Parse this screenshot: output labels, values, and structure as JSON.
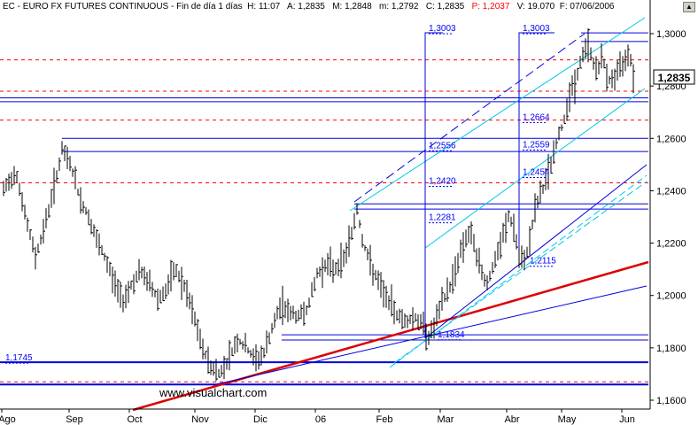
{
  "title": {
    "symbol": "EC - EURO FX FUTURES CONTINUOUS - Fin de día 1 días",
    "hour": "H: 11:07",
    "open": "A: 1,2835",
    "high": "M: 1,2848",
    "low": "m: 1,2792",
    "close": "C: 1,2835",
    "prev_label": "P: 1,2037",
    "volume": "V: 19.070",
    "date": "F: 07/06/2006"
  },
  "last_price": "1,2835",
  "watermark": "www.visualchart.com",
  "colors": {
    "bars": "#000000",
    "levels": "#0000ff",
    "dashed": "#ff0000",
    "trend_red": "#dd0000",
    "channel_cyan": "#00c8e8",
    "channel_blue": "#0000dd"
  },
  "chart_data": {
    "type": "ohlc",
    "y_ticks": [
      "1,3000",
      "1,2800",
      "1,2600",
      "1,2400",
      "1,2200",
      "1,2000",
      "1,1800",
      "1,1600"
    ],
    "y_tick_values": [
      1.3,
      1.28,
      1.26,
      1.24,
      1.22,
      1.2,
      1.18,
      1.16
    ],
    "ylim": [
      1.1575,
      1.3075
    ],
    "x_labels": [
      "Ago",
      "Sep",
      "Oct",
      "Nov",
      "Dic",
      "06",
      "Feb",
      "Mar",
      "Abr",
      "May",
      "Jun"
    ],
    "level_labels": [
      "1,3003",
      "1,3003",
      "1,2664",
      "1,2556",
      "1,2559",
      "1,2420",
      "1,2454",
      "1,2281",
      "1,2115",
      "1,1834",
      "1,1745"
    ],
    "level_label_values": [
      1.3003,
      1.3003,
      1.2664,
      1.2556,
      1.2559,
      1.242,
      1.2454,
      1.2281,
      1.2115,
      1.1834,
      1.1745
    ],
    "horizontal_levels": [
      1.3003,
      1.297,
      1.2755,
      1.274,
      1.26,
      1.255,
      1.235,
      1.233,
      1.185,
      1.183,
      1.1745,
      1.166
    ],
    "dashed_levels": [
      1.29,
      1.278,
      1.267,
      1.243,
      1.167
    ],
    "price_path": [
      [
        0,
        1.238
      ],
      [
        10,
        1.243
      ],
      [
        18,
        1.248
      ],
      [
        25,
        1.236
      ],
      [
        30,
        1.228
      ],
      [
        40,
        1.215
      ],
      [
        50,
        1.226
      ],
      [
        60,
        1.24
      ],
      [
        70,
        1.255
      ],
      [
        80,
        1.25
      ],
      [
        90,
        1.237
      ],
      [
        100,
        1.23
      ],
      [
        110,
        1.22
      ],
      [
        120,
        1.213
      ],
      [
        128,
        1.206
      ],
      [
        138,
        1.198
      ],
      [
        148,
        1.204
      ],
      [
        158,
        1.209
      ],
      [
        168,
        1.205
      ],
      [
        178,
        1.199
      ],
      [
        188,
        1.202
      ],
      [
        198,
        1.21
      ],
      [
        208,
        1.203
      ],
      [
        218,
        1.193
      ],
      [
        228,
        1.18
      ],
      [
        238,
        1.173
      ],
      [
        248,
        1.17
      ],
      [
        258,
        1.176
      ],
      [
        268,
        1.183
      ],
      [
        278,
        1.18
      ],
      [
        288,
        1.175
      ],
      [
        298,
        1.178
      ],
      [
        308,
        1.188
      ],
      [
        318,
        1.197
      ],
      [
        328,
        1.193
      ],
      [
        338,
        1.192
      ],
      [
        348,
        1.196
      ],
      [
        358,
        1.208
      ],
      [
        368,
        1.212
      ],
      [
        378,
        1.21
      ],
      [
        388,
        1.214
      ],
      [
        398,
        1.225
      ],
      [
        403,
        1.233
      ],
      [
        410,
        1.22
      ],
      [
        418,
        1.212
      ],
      [
        428,
        1.204
      ],
      [
        438,
        1.198
      ],
      [
        448,
        1.193
      ],
      [
        458,
        1.19
      ],
      [
        468,
        1.192
      ],
      [
        478,
        1.188
      ],
      [
        485,
        1.184
      ],
      [
        492,
        1.19
      ],
      [
        500,
        1.198
      ],
      [
        510,
        1.205
      ],
      [
        518,
        1.215
      ],
      [
        528,
        1.224
      ],
      [
        535,
        1.22
      ],
      [
        542,
        1.21
      ],
      [
        550,
        1.205
      ],
      [
        558,
        1.212
      ],
      [
        566,
        1.22
      ],
      [
        574,
        1.23
      ],
      [
        580,
        1.226
      ],
      [
        586,
        1.214
      ],
      [
        592,
        1.212
      ],
      [
        598,
        1.222
      ],
      [
        605,
        1.234
      ],
      [
        612,
        1.24
      ],
      [
        620,
        1.248
      ],
      [
        628,
        1.258
      ],
      [
        636,
        1.266
      ],
      [
        642,
        1.276
      ],
      [
        650,
        1.282
      ],
      [
        658,
        1.292
      ],
      [
        664,
        1.296
      ],
      [
        672,
        1.286
      ],
      [
        680,
        1.29
      ],
      [
        688,
        1.282
      ],
      [
        696,
        1.284
      ],
      [
        702,
        1.288
      ],
      [
        710,
        1.294
      ],
      [
        716,
        1.283
      ]
    ]
  }
}
